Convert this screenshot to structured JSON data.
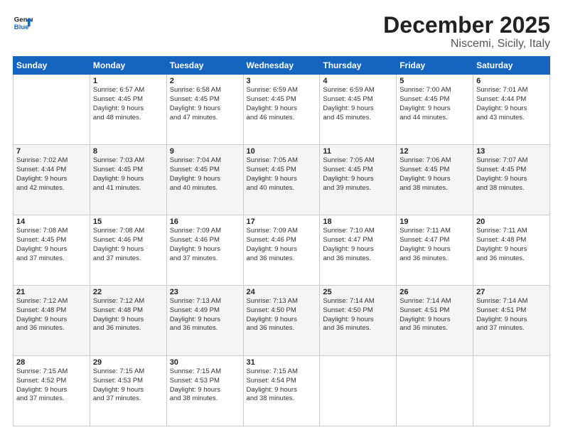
{
  "logo": {
    "line1": "General",
    "line2": "Blue"
  },
  "title": "December 2025",
  "subtitle": "Niscemi, Sicily, Italy",
  "days_of_week": [
    "Sunday",
    "Monday",
    "Tuesday",
    "Wednesday",
    "Thursday",
    "Friday",
    "Saturday"
  ],
  "weeks": [
    [
      {
        "day": "",
        "info": ""
      },
      {
        "day": "1",
        "info": "Sunrise: 6:57 AM\nSunset: 4:45 PM\nDaylight: 9 hours\nand 48 minutes."
      },
      {
        "day": "2",
        "info": "Sunrise: 6:58 AM\nSunset: 4:45 PM\nDaylight: 9 hours\nand 47 minutes."
      },
      {
        "day": "3",
        "info": "Sunrise: 6:59 AM\nSunset: 4:45 PM\nDaylight: 9 hours\nand 46 minutes."
      },
      {
        "day": "4",
        "info": "Sunrise: 6:59 AM\nSunset: 4:45 PM\nDaylight: 9 hours\nand 45 minutes."
      },
      {
        "day": "5",
        "info": "Sunrise: 7:00 AM\nSunset: 4:45 PM\nDaylight: 9 hours\nand 44 minutes."
      },
      {
        "day": "6",
        "info": "Sunrise: 7:01 AM\nSunset: 4:44 PM\nDaylight: 9 hours\nand 43 minutes."
      }
    ],
    [
      {
        "day": "7",
        "info": "Sunrise: 7:02 AM\nSunset: 4:44 PM\nDaylight: 9 hours\nand 42 minutes."
      },
      {
        "day": "8",
        "info": "Sunrise: 7:03 AM\nSunset: 4:45 PM\nDaylight: 9 hours\nand 41 minutes."
      },
      {
        "day": "9",
        "info": "Sunrise: 7:04 AM\nSunset: 4:45 PM\nDaylight: 9 hours\nand 40 minutes."
      },
      {
        "day": "10",
        "info": "Sunrise: 7:05 AM\nSunset: 4:45 PM\nDaylight: 9 hours\nand 40 minutes."
      },
      {
        "day": "11",
        "info": "Sunrise: 7:05 AM\nSunset: 4:45 PM\nDaylight: 9 hours\nand 39 minutes."
      },
      {
        "day": "12",
        "info": "Sunrise: 7:06 AM\nSunset: 4:45 PM\nDaylight: 9 hours\nand 38 minutes."
      },
      {
        "day": "13",
        "info": "Sunrise: 7:07 AM\nSunset: 4:45 PM\nDaylight: 9 hours\nand 38 minutes."
      }
    ],
    [
      {
        "day": "14",
        "info": "Sunrise: 7:08 AM\nSunset: 4:45 PM\nDaylight: 9 hours\nand 37 minutes."
      },
      {
        "day": "15",
        "info": "Sunrise: 7:08 AM\nSunset: 4:46 PM\nDaylight: 9 hours\nand 37 minutes."
      },
      {
        "day": "16",
        "info": "Sunrise: 7:09 AM\nSunset: 4:46 PM\nDaylight: 9 hours\nand 37 minutes."
      },
      {
        "day": "17",
        "info": "Sunrise: 7:09 AM\nSunset: 4:46 PM\nDaylight: 9 hours\nand 36 minutes."
      },
      {
        "day": "18",
        "info": "Sunrise: 7:10 AM\nSunset: 4:47 PM\nDaylight: 9 hours\nand 36 minutes."
      },
      {
        "day": "19",
        "info": "Sunrise: 7:11 AM\nSunset: 4:47 PM\nDaylight: 9 hours\nand 36 minutes."
      },
      {
        "day": "20",
        "info": "Sunrise: 7:11 AM\nSunset: 4:48 PM\nDaylight: 9 hours\nand 36 minutes."
      }
    ],
    [
      {
        "day": "21",
        "info": "Sunrise: 7:12 AM\nSunset: 4:48 PM\nDaylight: 9 hours\nand 36 minutes."
      },
      {
        "day": "22",
        "info": "Sunrise: 7:12 AM\nSunset: 4:48 PM\nDaylight: 9 hours\nand 36 minutes."
      },
      {
        "day": "23",
        "info": "Sunrise: 7:13 AM\nSunset: 4:49 PM\nDaylight: 9 hours\nand 36 minutes."
      },
      {
        "day": "24",
        "info": "Sunrise: 7:13 AM\nSunset: 4:50 PM\nDaylight: 9 hours\nand 36 minutes."
      },
      {
        "day": "25",
        "info": "Sunrise: 7:14 AM\nSunset: 4:50 PM\nDaylight: 9 hours\nand 36 minutes."
      },
      {
        "day": "26",
        "info": "Sunrise: 7:14 AM\nSunset: 4:51 PM\nDaylight: 9 hours\nand 36 minutes."
      },
      {
        "day": "27",
        "info": "Sunrise: 7:14 AM\nSunset: 4:51 PM\nDaylight: 9 hours\nand 37 minutes."
      }
    ],
    [
      {
        "day": "28",
        "info": "Sunrise: 7:15 AM\nSunset: 4:52 PM\nDaylight: 9 hours\nand 37 minutes."
      },
      {
        "day": "29",
        "info": "Sunrise: 7:15 AM\nSunset: 4:53 PM\nDaylight: 9 hours\nand 37 minutes."
      },
      {
        "day": "30",
        "info": "Sunrise: 7:15 AM\nSunset: 4:53 PM\nDaylight: 9 hours\nand 38 minutes."
      },
      {
        "day": "31",
        "info": "Sunrise: 7:15 AM\nSunset: 4:54 PM\nDaylight: 9 hours\nand 38 minutes."
      },
      {
        "day": "",
        "info": ""
      },
      {
        "day": "",
        "info": ""
      },
      {
        "day": "",
        "info": ""
      }
    ]
  ]
}
